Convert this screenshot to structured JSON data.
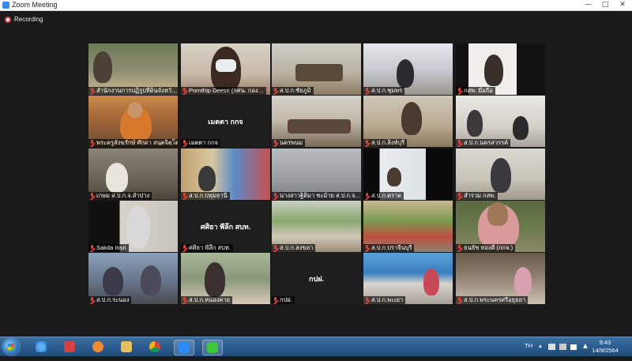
{
  "window": {
    "title": "Zoom Meeting",
    "controls": [
      "minimize",
      "maximize",
      "close"
    ],
    "status": "Recording"
  },
  "participants": [
    {
      "name": "สำนักงานการปฏิรูปที่ดินจังหวั…",
      "muted": true
    },
    {
      "name": "Pornthip Deesri (กศน. กอง…",
      "muted": true
    },
    {
      "name": "ส.ป.ก.ชัยภูมิ",
      "muted": true
    },
    {
      "name": "ส.ป.ก.ชุมพร",
      "muted": true
    },
    {
      "name": "กสพ. มือถือ",
      "muted": true
    },
    {
      "name": "พระครูสังฆรักษ์ ศักดา สนฺตจิตฺโต",
      "muted": true,
      "active": true
    },
    {
      "name": "เมตตา กกจ",
      "muted": true,
      "display_name": "เมตตา กกจ"
    },
    {
      "name": "นครพนม",
      "muted": true
    },
    {
      "name": "ส.ป.ก.สิงห์บุรี",
      "muted": true
    },
    {
      "name": "ส.ป.ก.นครสวรรค์",
      "muted": true
    },
    {
      "name": "เกษม ส.ป.ก.จ.ลำปาง",
      "muted": true
    },
    {
      "name": "ส.ป.ก.ปทุมธานี",
      "muted": true
    },
    {
      "name": "นางสาวฐิติมา ชะม้าย ส.ป.ก.จ.…",
      "muted": true
    },
    {
      "name": "ส.ป.ก.ตราด",
      "muted": true
    },
    {
      "name": "สำรวม กสพ.",
      "muted": true
    },
    {
      "name": "Sakda Insri",
      "muted": true
    },
    {
      "name": "ศศิธา พีลึก สบท.",
      "muted": true,
      "display_name": "ศศิธา พีลึก สบท."
    },
    {
      "name": "ส.ป.ก.สงขลา",
      "muted": true
    },
    {
      "name": "ส.ป.ก.ปราจีนบุรี",
      "muted": true
    },
    {
      "name": "ธนธัช ทองดี (กกจ.)",
      "muted": true
    },
    {
      "name": "ส.ป.ก.ระนอง",
      "muted": true
    },
    {
      "name": "ส.ป.ก.หนองคาย",
      "muted": true
    },
    {
      "name": "กปฝ.",
      "muted": true,
      "display_name": "กปฝ."
    },
    {
      "name": "ส.ป.ก.พะเยา",
      "muted": true
    },
    {
      "name": "ส.ป.ก.พระนครศรีอยุธยา",
      "muted": true
    }
  ],
  "taskbar": {
    "apps": [
      "internet-explorer",
      "screenshot-tool",
      "media-player",
      "file-explorer",
      "chrome",
      "zoom",
      "line"
    ],
    "tray": {
      "language": "TH"
    },
    "clock": {
      "time": "9:43",
      "date": "14/9/2564"
    }
  },
  "colors": {
    "active_speaker_border": "#e6e65a",
    "muted_icon": "#e0403a",
    "zoom_blue": "#2d8cff",
    "taskbar": "#2a5c90"
  }
}
